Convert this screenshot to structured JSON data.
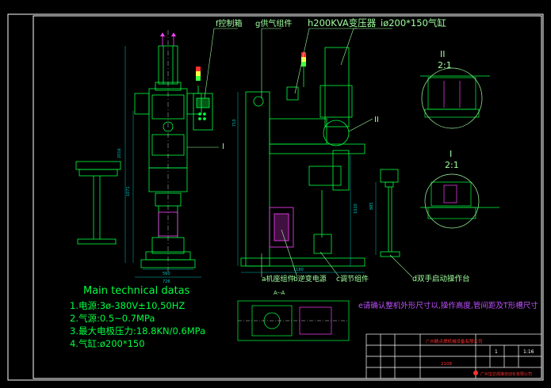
{
  "callouts": {
    "f": "f控制箱",
    "g": "g供气组件",
    "h": "h200KVA变压器",
    "i": "iø200*150气缸",
    "a": "a机座组件",
    "b": "b逆变电源",
    "c": "c调节组件",
    "d": "d双手启动操作台"
  },
  "section_marks": {
    "sec1": "I",
    "sec2": "II",
    "aa": "A--A"
  },
  "details": {
    "d2_label": "II",
    "d2_scale": "2:1",
    "d1_label": "I",
    "d1_scale": "2:1"
  },
  "dims": {
    "h_overall": "2016",
    "h_part": "1071",
    "h_right": "710",
    "h_right_low": "1020",
    "w_base": "560",
    "w_total": "726",
    "w_side": "1180",
    "h_stand": "885"
  },
  "tech": {
    "title": "Main technical datas",
    "l1": "1.电源:3ø-380V±10,50HZ",
    "l2": "2.气源:0.5~0.7MPa",
    "l3": "3.最大电极压力:18.8KN/0.6MPa",
    "l4": "4.气缸:ø200*150"
  },
  "note": "e请确认整机外形尺寸以,操作高度,管间距及T形槽尺寸",
  "title_block": {
    "name": "广州精点焊机械设备有限公司",
    "drawing_no": "2108",
    "scale": "1:16",
    "sheet": "1",
    "company": "广州宝达焊接自动化有限公司"
  },
  "colors": {
    "background": "#000000",
    "frame": "#ffffff",
    "machine": "#00ff40",
    "dimension": "#00c0c0",
    "callout": "#a0ffa0",
    "note": "#c050ff",
    "title_text": "#ff3030"
  }
}
